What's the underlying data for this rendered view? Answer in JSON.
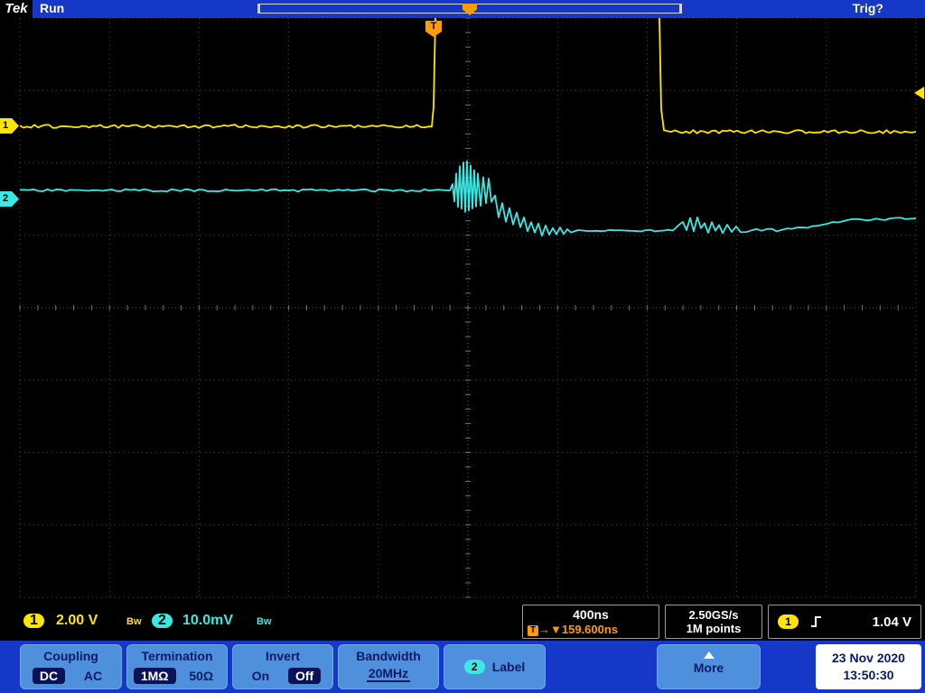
{
  "topbar": {
    "logo": "Tek",
    "status": "Run",
    "trigger_status": "Trig?"
  },
  "graticule_markers": {
    "trigger_flag": "T",
    "ch1_badge": "1",
    "ch2_badge": "2"
  },
  "status": {
    "ch1": {
      "badge": "1",
      "scale": "2.00 V",
      "bw": "Bw"
    },
    "ch2": {
      "badge": "2",
      "scale": "10.0mV",
      "bw": "Bw"
    },
    "horizontal": {
      "scale": "400ns",
      "delay_prefix": "T",
      "delay_arrows": "→▼",
      "delay": "159.600ns"
    },
    "acquisition": {
      "sample_rate": "2.50GS/s",
      "record_length": "1M points"
    },
    "trigger": {
      "source_badge": "1",
      "level": "1.04 V"
    }
  },
  "menu": {
    "coupling": {
      "title": "Coupling",
      "options": [
        {
          "label": "DC",
          "selected": true
        },
        {
          "label": "AC",
          "selected": false
        }
      ]
    },
    "termination": {
      "title": "Termination",
      "options": [
        {
          "label": "1MΩ",
          "selected": true
        },
        {
          "label": "50Ω",
          "selected": false
        }
      ]
    },
    "invert": {
      "title": "Invert",
      "options": [
        {
          "label": "On",
          "selected": false
        },
        {
          "label": "Off",
          "selected": true
        }
      ]
    },
    "bandwidth": {
      "title": "Bandwidth",
      "value": "20MHz"
    },
    "label": {
      "badge": "2",
      "title": "Label"
    },
    "more": {
      "title": "More"
    },
    "datetime": {
      "date": "23 Nov 2020",
      "time": "13:50:30"
    }
  },
  "colors": {
    "ch1": "#ffe600",
    "ch2": "#3ce8e2",
    "trigger": "#ff9d00"
  },
  "chart_data": {
    "type": "line",
    "title": "Oscilloscope acquisition",
    "x_axis": "time, 400ns/div, trigger delay 159.600ns",
    "series": [
      {
        "name": "CH1",
        "color": "#ffe600",
        "scale": "2.00 V/div",
        "seed": 7,
        "noise": 1.8,
        "step": 4,
        "points": [
          [
            22,
            140
          ],
          [
            200,
            140
          ],
          [
            380,
            140
          ],
          [
            474,
            140
          ],
          [
            478,
            139
          ],
          [
            480,
            120
          ],
          [
            482,
            20
          ],
          [
            483,
            -6
          ],
          [
            600,
            -6
          ],
          [
            728,
            -6
          ],
          [
            730,
            20
          ],
          [
            732,
            120
          ],
          [
            735,
            146
          ],
          [
            800,
            146
          ],
          [
            900,
            146
          ],
          [
            1014,
            146
          ]
        ]
      },
      {
        "name": "CH2",
        "color": "#3ce8e2",
        "scale": "10.0mV/div",
        "seed": 11,
        "noise": 1.4,
        "step": 5,
        "points": [
          [
            22,
            211
          ],
          [
            200,
            211
          ],
          [
            400,
            211
          ],
          [
            490,
            211
          ],
          [
            498,
            210
          ],
          [
            501,
            204
          ],
          [
            503,
            222
          ],
          [
            505,
            192
          ],
          [
            507,
            228
          ],
          [
            509,
            185
          ],
          [
            511,
            231
          ],
          [
            513,
            180
          ],
          [
            515,
            236
          ],
          [
            517,
            178
          ],
          [
            519,
            234
          ],
          [
            521,
            184
          ],
          [
            523,
            231
          ],
          [
            525,
            188
          ],
          [
            527,
            229
          ],
          [
            529,
            192
          ],
          [
            532,
            227
          ],
          [
            535,
            196
          ],
          [
            538,
            225
          ],
          [
            541,
            199
          ],
          [
            544,
            223
          ],
          [
            548,
            216
          ],
          [
            552,
            240
          ],
          [
            556,
            226
          ],
          [
            560,
            246
          ],
          [
            564,
            231
          ],
          [
            568,
            250
          ],
          [
            572,
            237
          ],
          [
            576,
            253
          ],
          [
            580,
            242
          ],
          [
            584,
            256
          ],
          [
            588,
            245
          ],
          [
            592,
            258
          ],
          [
            596,
            248
          ],
          [
            600,
            260
          ],
          [
            604,
            250
          ],
          [
            608,
            259
          ],
          [
            612,
            252
          ],
          [
            616,
            260
          ],
          [
            620,
            253
          ],
          [
            624,
            259
          ],
          [
            628,
            254
          ],
          [
            632,
            258
          ],
          [
            640,
            256
          ],
          [
            660,
            256
          ],
          [
            690,
            255
          ],
          [
            720,
            256
          ],
          [
            745,
            255
          ],
          [
            752,
            250
          ],
          [
            756,
            245
          ],
          [
            760,
            256
          ],
          [
            764,
            241
          ],
          [
            768,
            255
          ],
          [
            772,
            240
          ],
          [
            776,
            254
          ],
          [
            780,
            246
          ],
          [
            784,
            257
          ],
          [
            788,
            247
          ],
          [
            792,
            256
          ],
          [
            796,
            250
          ],
          [
            800,
            257
          ],
          [
            805,
            250
          ],
          [
            810,
            257
          ],
          [
            815,
            252
          ],
          [
            820,
            257
          ],
          [
            832,
            255
          ],
          [
            860,
            255
          ],
          [
            888,
            253
          ],
          [
            905,
            251
          ],
          [
            922,
            247
          ],
          [
            938,
            244
          ],
          [
            955,
            243
          ],
          [
            985,
            243
          ],
          [
            1014,
            242
          ]
        ]
      }
    ]
  }
}
